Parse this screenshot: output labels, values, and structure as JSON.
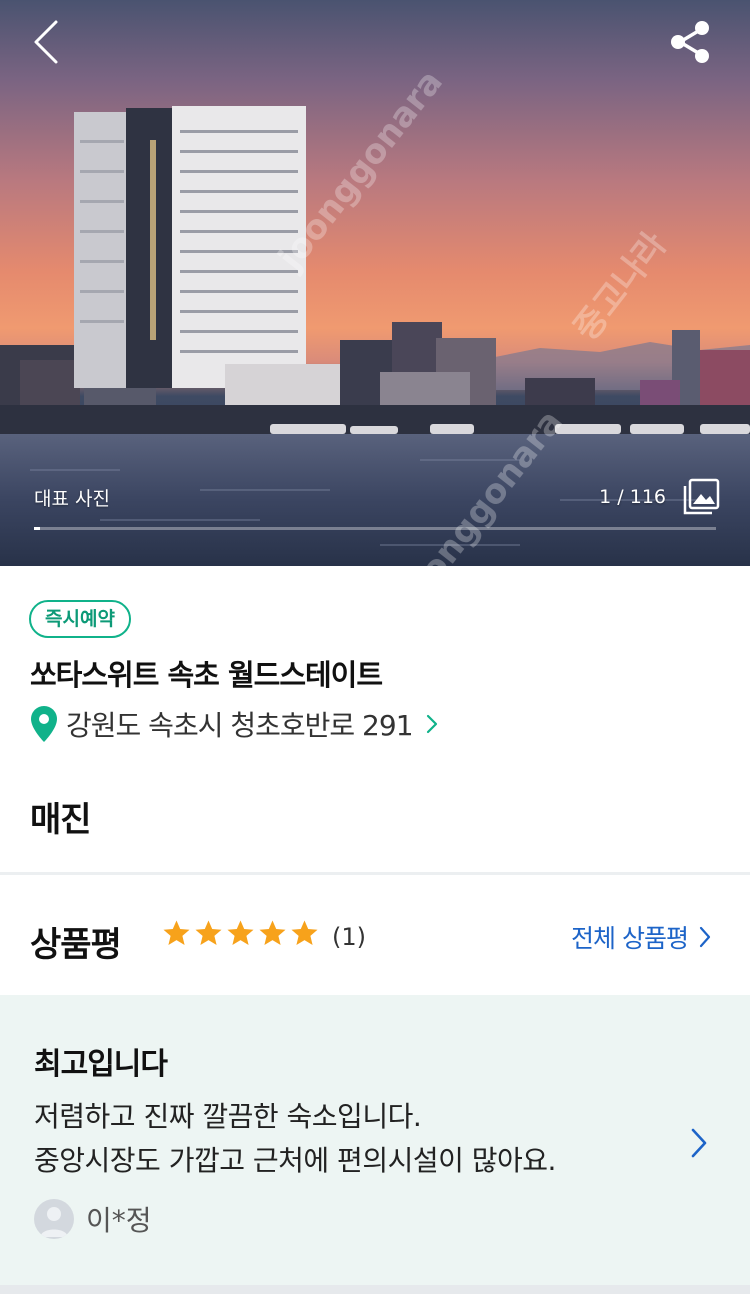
{
  "hero": {
    "caption": "대표 사진",
    "counter": "1 / 116",
    "progress": 0.0086,
    "watermark": "중고나라",
    "watermark_en": "joonggonara",
    "back_icon": "chevron-left-icon",
    "share_icon": "share-icon",
    "gallery_icon": "gallery-icon"
  },
  "info": {
    "badge": "즉시예약",
    "hotel_name": "쏘타스위트 속초 월드스테이트",
    "address": "강원도 속초시 청초호반로 291",
    "status": "매진",
    "accent_color": "#10b28a"
  },
  "reviews": {
    "title": "상품평",
    "rating": 5,
    "count_text": "(1)",
    "all_link": "전체 상품평",
    "star_color": "#f7a21b",
    "link_color": "#1d64c8",
    "item": {
      "headline": "최고입니다",
      "body_line1": "저렴하고 진짜 깔끔한 숙소입니다.",
      "body_line2": "중앙시장도 가깝고 근처에 편의시설이 많아요.",
      "reviewer": "이*정"
    }
  }
}
